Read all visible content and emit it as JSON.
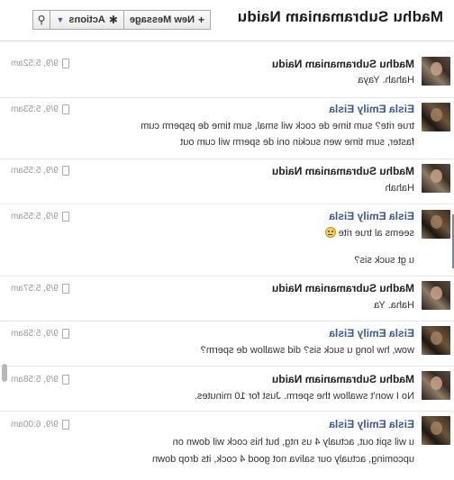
{
  "header": {
    "title": "Madhu Subramaniam Naidu",
    "new_message_label": "New Message",
    "actions_label": "Actions",
    "new_message_glyph": "+",
    "actions_glyph": "✱",
    "search_glyph": "⚲"
  },
  "messages": [
    {
      "name": "Madhu Subramaniam Naidu",
      "time": "9/9, 5:52am",
      "lines": [
        "Hahah. Yaya"
      ]
    },
    {
      "name": "Eisla Emily Eisla",
      "time": "9/9, 5:53am",
      "lines": [
        "true rite? sum time de cock wil smal, sum time de psperm cum",
        "faster, sum time wen suckin oni de sperm wil cum out"
      ]
    },
    {
      "name": "Madhu Subramaniam Naidu",
      "time": "9/9, 5:55am",
      "lines": [
        "Hahah"
      ]
    },
    {
      "name": "Eisla Emily Eisla",
      "time": "9/9, 5:55am",
      "lines": [
        "seems al true rite",
        "u gt suck sis?"
      ]
    },
    {
      "name": "Madhu Subramaniam Naidu",
      "time": "9/9, 5:57am",
      "lines": [
        "Haha. Ya"
      ]
    },
    {
      "name": "Eisla Emily Eisla",
      "time": "9/9, 5:58am",
      "lines": [
        "wow, hw long u suck sis? did swallow de sperm?"
      ]
    },
    {
      "name": "Madhu Subramaniam Naidu",
      "time": "9/9, 5:58am",
      "lines": [
        "No I won't swallow the sperm. Just for 10 minutes."
      ]
    },
    {
      "name": "Eisla Emily Eisla",
      "time": "9/9, 6:00am",
      "lines": [
        "u wil spit out, actualy 4 us ntg, but his cock wil down on",
        "upcoming, actualy our saliva not good 4 cock, its drop down"
      ]
    }
  ],
  "icons": [
    "search-icon",
    "gear-icon",
    "plus-icon",
    "chevron-down-icon",
    "mobile-icon",
    "smiley-icon"
  ]
}
